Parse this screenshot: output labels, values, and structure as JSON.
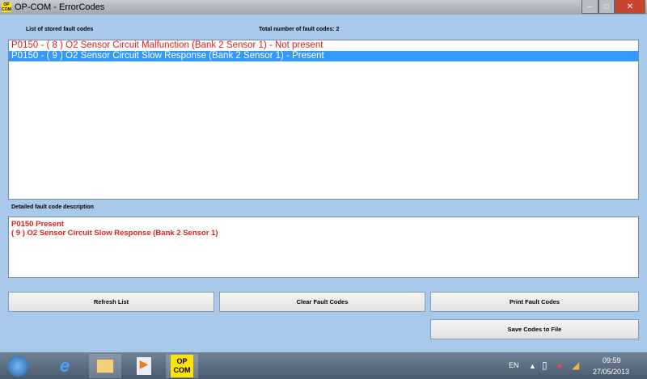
{
  "window": {
    "title": "OP-COM - ErrorCodes",
    "icon_text": "OP COM"
  },
  "labels": {
    "list": "List of stored fault codes",
    "total": "Total number of fault codes:  2",
    "detail": "Detailed fault code description"
  },
  "fault_codes": [
    {
      "text": "P0150 - ( 8 )  O2 Sensor Circuit Malfunction (Bank 2 Sensor 1) - Not present",
      "selected": false
    },
    {
      "text": "P0150 - ( 9 )  O2 Sensor Circuit Slow Response (Bank 2 Sensor 1) - Present",
      "selected": true
    }
  ],
  "detail": {
    "line1": "P0150  Present",
    "line2": "( 9 )  O2 Sensor Circuit Slow Response (Bank 2 Sensor 1)"
  },
  "buttons": {
    "refresh": "Refresh List",
    "clear": "Clear Fault Codes",
    "print": "Print Fault Codes",
    "save": "Save Codes to File"
  },
  "taskbar": {
    "opcom": "OP COM",
    "lang": "EN",
    "time": "09:59",
    "date": "27/05/2013"
  }
}
